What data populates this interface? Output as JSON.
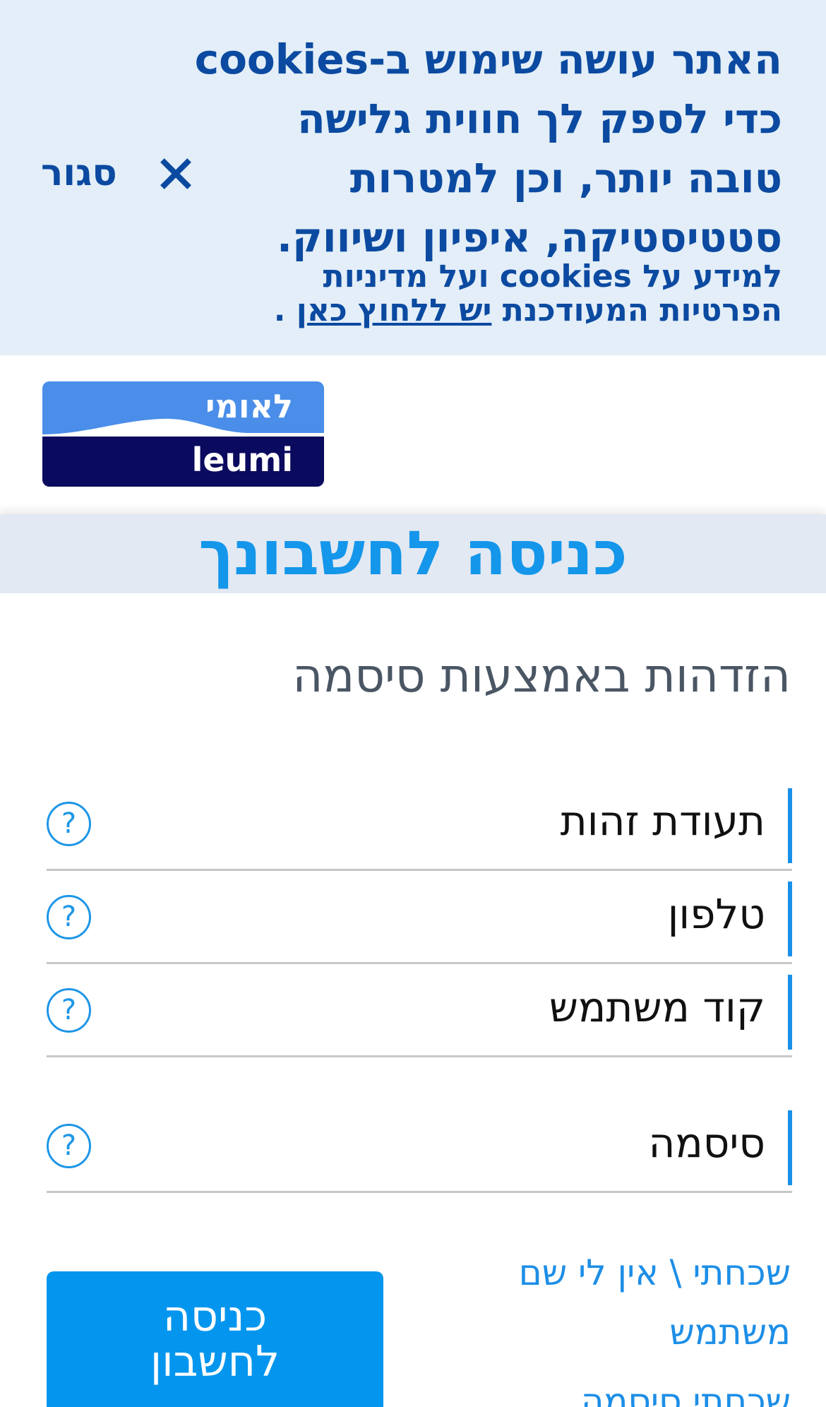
{
  "cookie_banner": {
    "line1": "האתר עושה שימוש ב-cookies",
    "line2": "כדי לספק לך חווית גלישה",
    "line3": "טובה יותר, וכן למטרות",
    "line4": "סטטיסטיקה, איפיון ושיווק.",
    "info_line": "למידע על cookies ועל מדיניות",
    "info_line2_prefix": "הפרטיות המעודכנת",
    "link_text": "יש ללחוץ כאן",
    "info_line2_suffix": ".",
    "close_label": "סגור"
  },
  "logo": {
    "hebrew": "לאומי",
    "english": "leumi",
    "colors": {
      "top": "#4a8ee9",
      "bottom": "#0a0a5e"
    }
  },
  "page": {
    "title": "כניסה לחשבונך",
    "section_title": "הזדהות באמצעות סיסמה"
  },
  "fields": [
    {
      "label": "תעודת זהות",
      "help": "?"
    },
    {
      "label": "טלפון",
      "help": "?"
    },
    {
      "label": "קוד משתמש",
      "help": "?"
    },
    {
      "label": "סיסמה",
      "help": "?"
    }
  ],
  "links": {
    "forgot_username_line1": "שכחתי \\ אין לי שם",
    "forgot_username_line2": "משתמש",
    "forgot_password": "שכחתי סיסמה"
  },
  "login_button": {
    "line1": "כניסה",
    "line2": "לחשבון"
  },
  "colors": {
    "banner_bg": "#e3eef8",
    "banner_text": "#0b4aa0",
    "accent": "#1496ea",
    "button": "#0496ee"
  }
}
